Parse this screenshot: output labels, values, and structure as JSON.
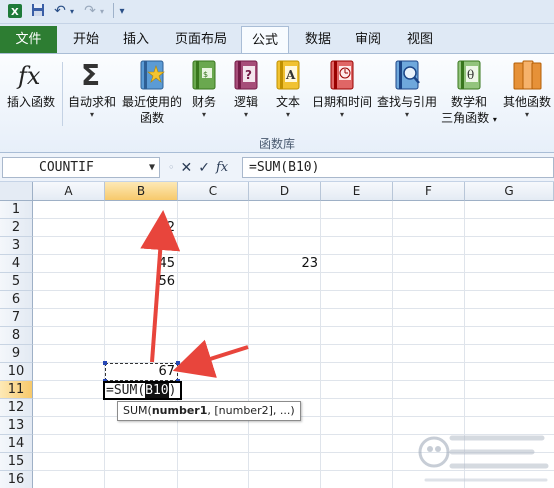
{
  "qat": {
    "save_icon": "save-icon",
    "undo_icon": "undo-icon",
    "redo_icon": "redo-icon",
    "customize_icon": "customize-qat-icon"
  },
  "tabs": [
    {
      "label": "文件",
      "active": false
    },
    {
      "label": "开始",
      "active": false
    },
    {
      "label": "插入",
      "active": false
    },
    {
      "label": "页面布局",
      "active": false
    },
    {
      "label": "公式",
      "active": true
    },
    {
      "label": "数据",
      "active": false
    },
    {
      "label": "审阅",
      "active": false
    },
    {
      "label": "视图",
      "active": false
    }
  ],
  "ribbon": {
    "group_label": "函数库",
    "buttons": [
      {
        "label": "插入函数",
        "label2": "",
        "icon": "fx-icon",
        "has_arrow": false
      },
      {
        "label": "自动求和",
        "label2": "",
        "icon": "sigma-icon",
        "has_arrow": true
      },
      {
        "label": "最近使用的",
        "label2": "函数",
        "icon": "recent-book-icon",
        "has_arrow": true
      },
      {
        "label": "财务",
        "label2": "",
        "icon": "finance-book-icon",
        "has_arrow": true
      },
      {
        "label": "逻辑",
        "label2": "",
        "icon": "logic-book-icon",
        "has_arrow": true
      },
      {
        "label": "文本",
        "label2": "",
        "icon": "text-book-icon",
        "has_arrow": true
      },
      {
        "label": "日期和时间",
        "label2": "",
        "icon": "datetime-book-icon",
        "has_arrow": true
      },
      {
        "label": "查找与引用",
        "label2": "",
        "icon": "lookup-book-icon",
        "has_arrow": true
      },
      {
        "label": "数学和",
        "label2": "三角函数",
        "icon": "math-book-icon",
        "has_arrow": true
      },
      {
        "label": "其他函数",
        "label2": "",
        "icon": "more-book-icon",
        "has_arrow": true
      }
    ]
  },
  "formula_bar": {
    "name_box": "COUNTIF",
    "cancel_glyph": "✕",
    "enter_glyph": "✓",
    "fx_glyph": "fx",
    "formula": "=SUM(B10)"
  },
  "grid": {
    "columns": [
      "A",
      "B",
      "C",
      "D",
      "E",
      "F",
      "G"
    ],
    "rows": [
      "1",
      "2",
      "3",
      "4",
      "5",
      "6",
      "7",
      "8",
      "9",
      "10",
      "11",
      "12",
      "13",
      "14",
      "15",
      "16"
    ],
    "selected_column": "B",
    "selected_row": "11",
    "cells": [
      {
        "ref": "B2",
        "value": "12"
      },
      {
        "ref": "B3",
        "value": "24"
      },
      {
        "ref": "B4",
        "value": "45"
      },
      {
        "ref": "D4",
        "value": "23"
      },
      {
        "ref": "B5",
        "value": "56"
      },
      {
        "ref": "B10",
        "value": "67"
      }
    ],
    "edit_cell": {
      "ref": "B11",
      "prefix": "=SUM(",
      "ref_text": "B10",
      "suffix": ")"
    },
    "tooltip": {
      "func": "SUM(",
      "arg1": "number1",
      "rest": ", [number2], ...)"
    }
  },
  "colors": {
    "file_tab": "#2d7d32",
    "selection_header": "#f7c96b",
    "arrow": "#e8453c",
    "handle": "#2647b5"
  },
  "watermark": {
    "icon": "baidu-jingyan-watermark"
  }
}
